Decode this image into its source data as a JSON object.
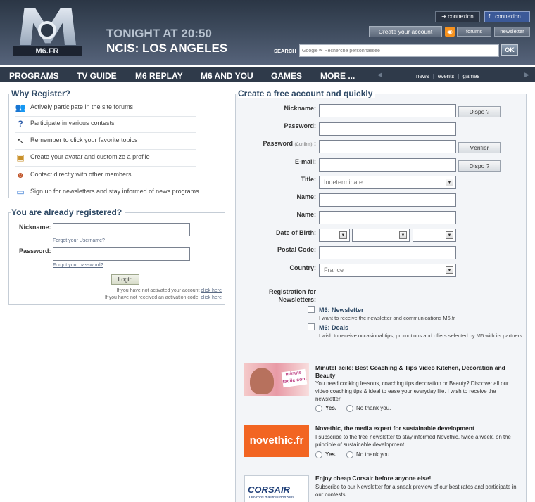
{
  "header": {
    "logo_text": "M6.FR",
    "tonight": "TONIGHT AT 20:50",
    "show": "NCIS: LOS ANGELES",
    "connexion": "connexion",
    "fb_connexion": "connexion",
    "create_account": "Create your account",
    "forums": "forums",
    "newsletter": "newsletter",
    "search_label": "SEARCH",
    "search_placeholder": "Google™ Recherche personnalisée",
    "ok": "OK"
  },
  "nav": {
    "items": [
      "PROGRAMS",
      "TV GUIDE",
      "M6 REPLAY",
      "M6 AND YOU",
      "GAMES",
      "MORE ..."
    ],
    "sub": [
      "news",
      "events",
      "games"
    ]
  },
  "why": {
    "title": "Why Register?",
    "items": [
      {
        "icon": "users-icon",
        "text": "Actively participate in the site forums"
      },
      {
        "icon": "question-icon",
        "text": "Participate in various contests"
      },
      {
        "icon": "click-icon",
        "text": "Remember to click your favorite topics"
      },
      {
        "icon": "profile-icon",
        "text": "Create your avatar and customize a profile"
      },
      {
        "icon": "contact-icon",
        "text": "Contact directly with other members"
      },
      {
        "icon": "newsletter-icon",
        "text": "Sign up for newsletters and stay informed of news programs"
      }
    ]
  },
  "login": {
    "title": "You are already registered?",
    "nickname_label": "Nickname:",
    "password_label": "Password:",
    "forgot_username": "Forgot your Username?",
    "forgot_password": "Forgot your password?",
    "login_button": "Login",
    "note1": "If you have not activated your account",
    "note2": "If you have not received an activation code,",
    "click_here": "click here"
  },
  "create": {
    "title": "Create a free account and quickly",
    "nickname": "Nickname:",
    "password": "Password:",
    "password_confirm": "Password",
    "confirm_small": "(Confirm)",
    "email": "E-mail:",
    "title_label": "Title:",
    "title_value": "Indeterminate",
    "name1": "Name:",
    "name2": "Name:",
    "dob": "Date of Birth:",
    "postal": "Postal Code:",
    "country": "Country:",
    "country_value": "France",
    "dispo": "Dispo ?",
    "verifier": "Vérifier",
    "dispo2": "Dispo ?",
    "reg_newsletters": "Registration for Newsletters:",
    "nl1_title": "M6: Newsletter",
    "nl1_desc": "I want to receive the newsletter and communications M6.fr",
    "nl2_title": "M6: Deals",
    "nl2_desc": "I wish to receive occasional tips, promotions and offers selected by M6 with its partners"
  },
  "promos": [
    {
      "brand": "minute facile.com",
      "title": "MinuteFacile: Best Coaching & Tips Video Kitchen, Decoration and Beauty",
      "desc": "You need cooking lessons, coaching tips decoration or Beauty? Discover all our video coaching tips & ideal to ease your everyday life. I wish to receive the newsletter:",
      "yes": "Yes.",
      "no": "No thank you."
    },
    {
      "brand": "novethic.fr",
      "title": "Novethic, the media expert for sustainable development",
      "desc": "I subscribe to the free newsletter to stay informed Novethic, twice a week, on the principle of sustainable development.",
      "yes": "Yes.",
      "no": "No thank you."
    },
    {
      "brand": "CORSAIR",
      "brand_sub": "Ouvrons d'autres horizons",
      "title": "Enjoy cheap Corsair before anyone else!",
      "desc": "Subscribe to our Newsletter for a sneak preview of our best rates and participate in our contests!"
    }
  ]
}
